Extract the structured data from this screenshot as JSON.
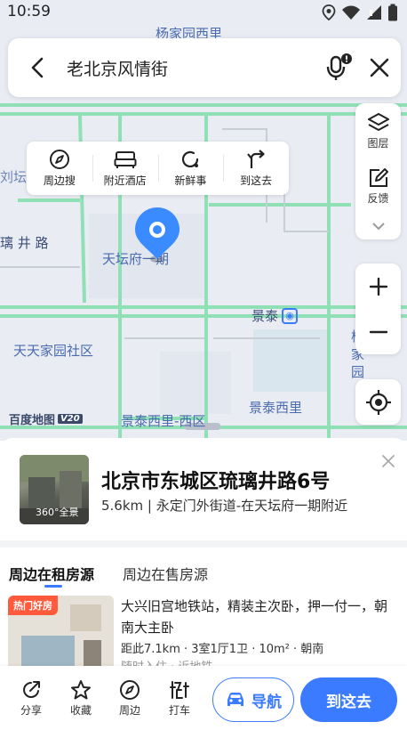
{
  "status_bar": {
    "time": "10:59"
  },
  "search": {
    "query": "老北京风情街"
  },
  "map": {
    "labels": {
      "top_street": "杨家园西里",
      "left_partial": "刘坛新",
      "road_left": "璃 井 路",
      "tiantan_fu": "天坛府一期",
      "jingtai": "景泰",
      "jingtai_right": "景泰西里",
      "right_vertical": "杨家园",
      "tiantian": "天天家园社区",
      "jingtai_west": "景泰西里-西区"
    },
    "logo_text": "百度地图",
    "logo_version": "V20"
  },
  "actions": [
    {
      "label": "周边搜",
      "icon": "compass-icon"
    },
    {
      "label": "附近酒店",
      "icon": "bed-icon"
    },
    {
      "label": "新鲜事",
      "icon": "refresh-circle-icon"
    },
    {
      "label": "到这去",
      "icon": "turn-arrow-icon"
    }
  ],
  "tools": {
    "layers_label": "图层",
    "feedback_label": "反馈"
  },
  "card": {
    "address": "北京市东城区琉璃井路6号",
    "subtitle": "5.6km | 永定门外街道-在天坛府一期附近",
    "panorama_label": "360°全景"
  },
  "tabs": {
    "rent": "周边在租房源",
    "sale": "周边在售房源"
  },
  "listing": {
    "badge": "热门好房",
    "title": "大兴旧宫地铁站，精装主次卧，押一付一，朝南大主卧",
    "meta": "距此7.1km · 3室1厅1卫 · 10m² · 朝南",
    "meta2": "随时入住 · 近地铁"
  },
  "bottom_bar": {
    "share": "分享",
    "favorite": "收藏",
    "nearby": "周边",
    "taxi": "打车",
    "navigate": "导航",
    "go_here": "到这去"
  },
  "colors": {
    "accent": "#3a7bff",
    "badge": "#ff5a3c",
    "road_green": "#8fe0b5",
    "map_bg": "#e9ecf3"
  }
}
